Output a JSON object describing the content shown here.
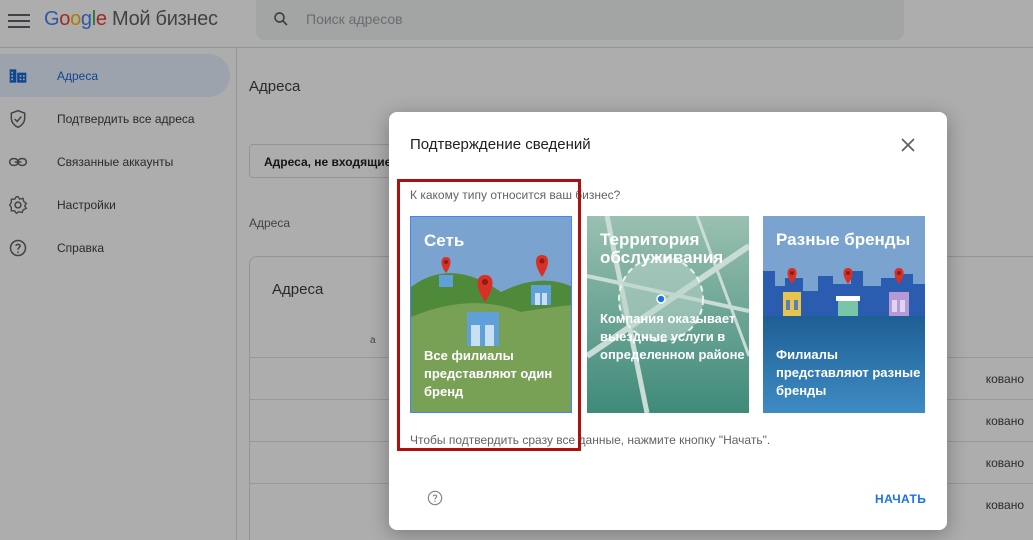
{
  "app": {
    "logo_brand": "Google",
    "logo_product": "Мой бизнес"
  },
  "search": {
    "placeholder": "Поиск адресов"
  },
  "sidebar": {
    "items": [
      {
        "label": "Адреса",
        "icon": "building-icon",
        "active": true
      },
      {
        "label": "Подтвердить все адреса",
        "icon": "shield-check-icon",
        "active": false
      },
      {
        "label": "Связанные аккаунты",
        "icon": "link-icon",
        "active": false
      },
      {
        "label": "Настройки",
        "icon": "gear-icon",
        "active": false
      },
      {
        "label": "Справка",
        "icon": "help-icon",
        "active": false
      }
    ]
  },
  "main": {
    "title": "Адреса",
    "filter_label": "Адреса, не входящие",
    "addresses_label": "Адреса",
    "card_title": "Адреса",
    "column_fragment": "а",
    "rows": [
      {
        "status": "ковано"
      },
      {
        "status": "ковано"
      },
      {
        "status": "ковано"
      },
      {
        "status": "ковано"
      }
    ]
  },
  "dialog": {
    "title": "Подтверждение сведений",
    "question": "К какому типу относится ваш бизнес?",
    "tiles": [
      {
        "title": "Сеть",
        "description": "Все филиалы представляют один бренд",
        "selected": true
      },
      {
        "title": "Территория обслуживания",
        "description": "Компания оказывает выездные услуги в определенном районе",
        "selected": false
      },
      {
        "title": "Разные бренды",
        "description": "Филиалы представляют разные бренды",
        "selected": false
      }
    ],
    "note": "Чтобы подтвердить сразу все данные, нажмите кнопку \"Начать\".",
    "start_label": "НАЧАТЬ"
  },
  "colors": {
    "accent": "#1a73e8",
    "highlight": "#b00f0f",
    "tile_chain": "#7a9c5a",
    "tile_area": "#5a9a8a",
    "tile_brand": "#2a6aa0"
  }
}
